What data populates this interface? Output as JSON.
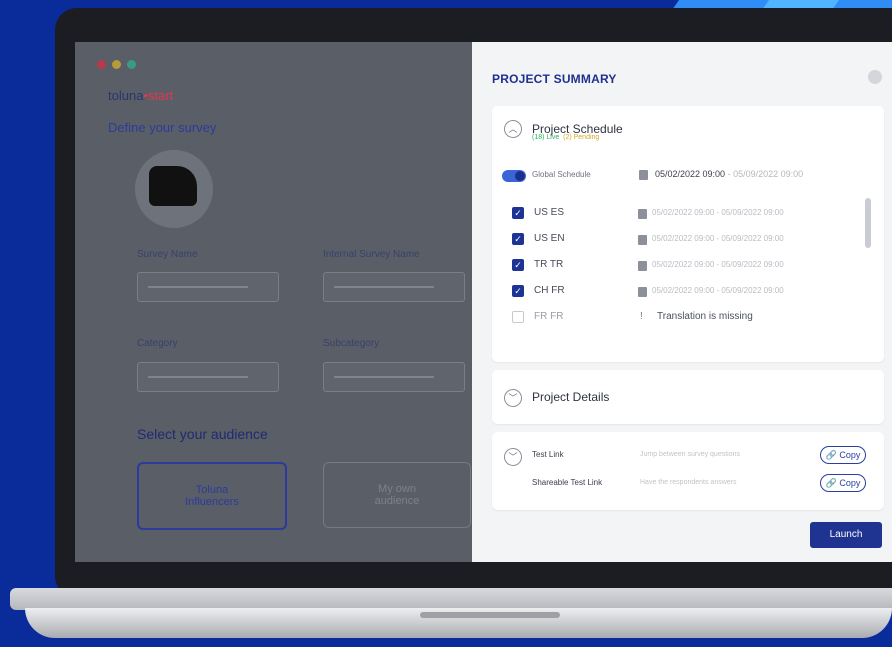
{
  "colors": {
    "brand_navy": "#1e3191",
    "launch_bg": "#1f3490",
    "background_blue": "#0a2b9a",
    "live": "#2fae5d",
    "pending": "#d5a82a"
  },
  "app": {
    "logo_main": "toluna",
    "logo_accent": "start",
    "define_title": "Define your survey",
    "fields": {
      "survey_name": "Survey Name",
      "internal_survey_name": "Internal Survey Name",
      "category": "Category",
      "subcategory": "Subcategory"
    },
    "audience_title": "Select your audience",
    "audience_options": [
      "Toluna Influencers",
      "My own audience"
    ]
  },
  "panel": {
    "title": "PROJECT SUMMARY",
    "schedule": {
      "title": "Project Schedule",
      "legend_live": "(18) Live",
      "legend_pending": "(2) Pending",
      "global_label": "Global Schedule",
      "global_start": "05/02/2022 09:00",
      "global_end": "- 05/09/2022 09:00",
      "rows": [
        {
          "label": "US ES",
          "checked": true,
          "dates": "05/02/2022 09:00 - 05/09/2022 09:00"
        },
        {
          "label": "US EN",
          "checked": true,
          "dates": "05/02/2022 09:00 - 05/09/2022 09:00"
        },
        {
          "label": "TR TR",
          "checked": true,
          "dates": "05/02/2022 09:00 - 05/09/2022 09:00"
        },
        {
          "label": "CH FR",
          "checked": true,
          "dates": "05/02/2022 09:00 - 05/09/2022 09:00"
        },
        {
          "label": "FR FR",
          "checked": false,
          "warning": "Translation is missing"
        }
      ]
    },
    "details": {
      "title": "Project Details"
    },
    "test_links": {
      "test_link_label": "Test Link",
      "test_link_value": "Jump between survey questions",
      "shareable_label": "Shareable Test Link",
      "shareable_value": "Have the respondents answers",
      "copy_label": "Copy"
    },
    "launch_label": "Launch"
  }
}
